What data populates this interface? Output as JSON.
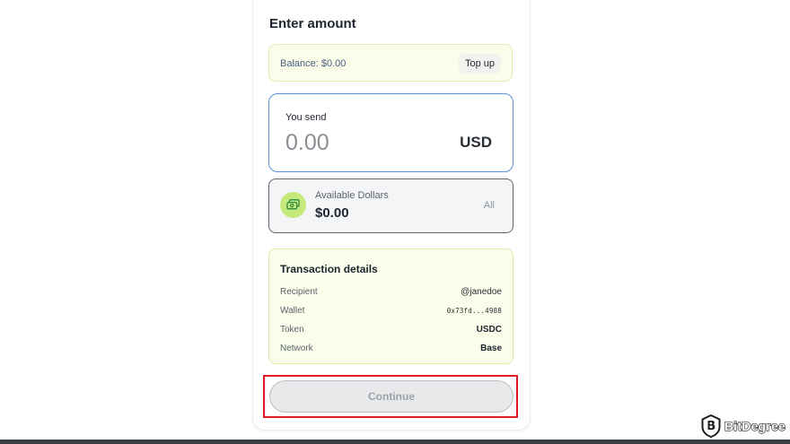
{
  "page": {
    "title": "Enter amount"
  },
  "balance": {
    "text": "Balance: $0.00",
    "topup_label": "Top up"
  },
  "send": {
    "label": "You send",
    "placeholder": "0.00",
    "currency": "USD"
  },
  "available": {
    "icon": "cash-icon",
    "label": "Available Dollars",
    "value": "$0.00",
    "all_label": "All"
  },
  "transaction": {
    "title": "Transaction details",
    "rows": [
      {
        "key": "Recipient",
        "value": "@janedoe"
      },
      {
        "key": "Wallet",
        "value": "0x73fd...4988"
      },
      {
        "key": "Token",
        "value": "USDC"
      },
      {
        "key": "Network",
        "value": "Base"
      }
    ]
  },
  "actions": {
    "continue_label": "Continue"
  },
  "watermark": {
    "name": "BitDegree"
  },
  "colors": {
    "accent_blue": "#5b93d9",
    "lime_bg": "#fafde9",
    "lime_icon": "#c5ea7c",
    "highlight_red": "#e01a22"
  }
}
